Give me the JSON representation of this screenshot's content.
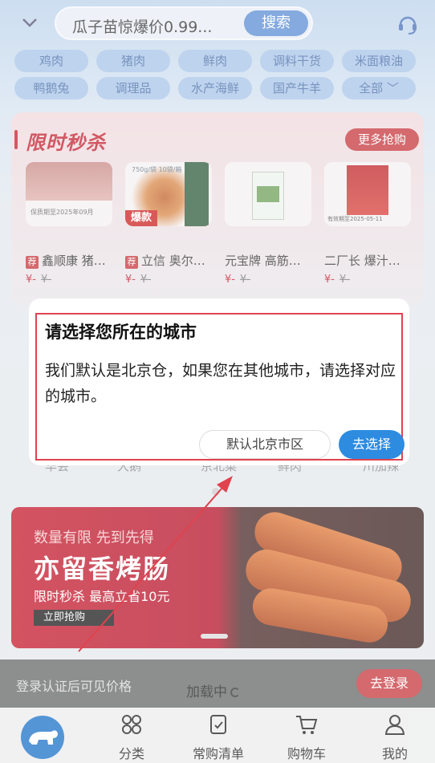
{
  "header": {
    "search_text": "瓜子苗惊爆价0.99...",
    "search_button": "搜索"
  },
  "categories": [
    "鸡肉",
    "猪肉",
    "鲜肉",
    "调料干货",
    "米面粮油",
    "鸭鹅兔",
    "调理品",
    "水产海鲜",
    "国产牛羊",
    "全部"
  ],
  "flash_sale": {
    "title": "限时秒杀",
    "more_button": "更多抢购",
    "products": [
      {
        "tag": "荐",
        "name": "鑫顺康 猪…",
        "price": "¥-",
        "original": "¥-",
        "img_caption": "保质期至2025年09月"
      },
      {
        "tag": "荐",
        "name": "立信 奥尔…",
        "price": "¥-",
        "original": "¥-",
        "img_caption": "爆款",
        "img_top": "750g/袋 10袋/箱"
      },
      {
        "tag": "",
        "name": "元宝牌 高筋…",
        "price": "¥-",
        "original": "¥-",
        "img_caption": ""
      },
      {
        "tag": "",
        "name": "二厂长 爆汁…",
        "price": "¥-",
        "original": "¥-",
        "img_caption": "有效期至2025-05-11"
      }
    ]
  },
  "brands_row": [
    "华会",
    "大鹅",
    "京北菜",
    "鲜肉",
    "川加辣"
  ],
  "banner": {
    "line1": "数量有限 先到先得",
    "line2": "亦留香烤肠",
    "line3": "限时秒杀 最高立省10元",
    "cta": "立即抢购"
  },
  "login_bar": {
    "text": "登录认证后可见价格",
    "button": "去登录",
    "loading": "加载中"
  },
  "tabs": [
    "分类",
    "常购清单",
    "购物车",
    "我的"
  ],
  "dialog": {
    "title": "请选择您所在的城市",
    "message": "我们默认是北京仓，如果您在其他城市，请选择对应的城市。",
    "default_button": "默认北京市区",
    "choose_button": "去选择"
  },
  "colors": {
    "accent_red": "#c6373e",
    "accent_blue": "#2d8be0",
    "highlight_frame": "#e0434e"
  }
}
